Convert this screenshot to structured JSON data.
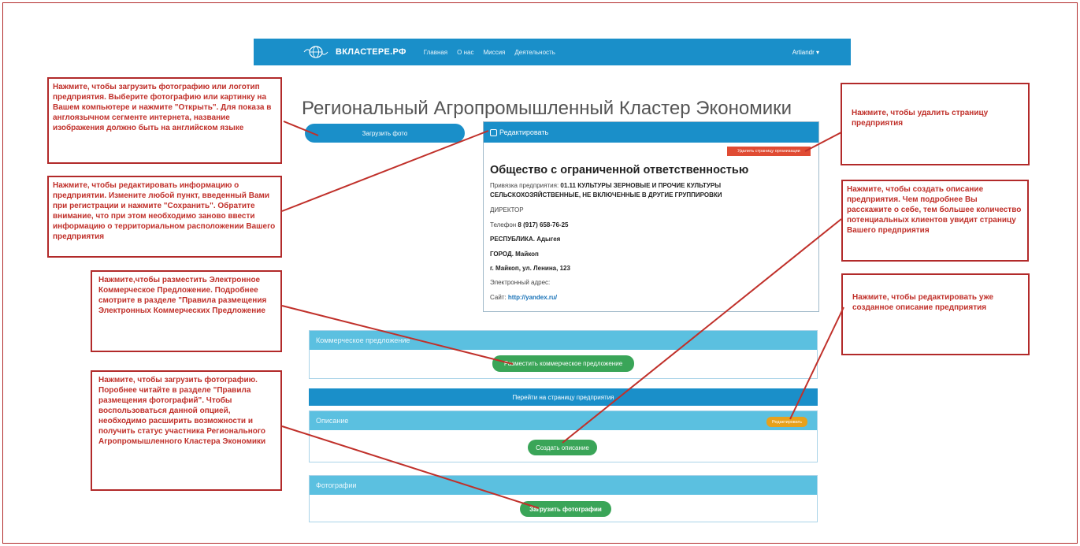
{
  "navbar": {
    "brand": "ВКЛАСТЕРЕ.РФ",
    "links": [
      "Главная",
      "О нас",
      "Миссия",
      "Деятельность"
    ],
    "user": "Artiandr ▾"
  },
  "page": {
    "title": "Региональный Агропромышленный Кластер Экономики",
    "upload_photo_label": "Загрузить фото"
  },
  "info": {
    "header_label": "Редактировать",
    "delete_label": "Удалить страницу организации",
    "org_name": "Общество с ограниченной ответственностью",
    "binding_label": "Привязка предприятия:",
    "binding_value_1": "01.11 КУЛЬТУРЫ ЗЕРНОВЫЕ И ПРОЧИЕ КУЛЬТУРЫ",
    "binding_value_2": "СЕЛЬСКОХОЗЯЙСТВЕННЫЕ, НЕ ВКЛЮЧЕННЫЕ В ДРУГИЕ ГРУППИРОВКИ",
    "director": "ДИРЕКТОР",
    "phone_label": "Телефон",
    "phone_value": "8 (917) 658-76-25",
    "republic": "РЕСПУБЛИКА. Адыгея",
    "city": "ГОРОД. Майкоп",
    "address": "г. Майкоп, ул. Ленина, 123",
    "email_label": "Электронный адрес:",
    "site_label": "Сайт:",
    "site_value": "http://yandex.ru/"
  },
  "commercial": {
    "header": "Коммерческое предложение",
    "button": "Разместить коммерческое предложение"
  },
  "goto_label": "Перейти на страницу предприятия",
  "description": {
    "header": "Описание",
    "edit_label": "Редактировать",
    "button": "Создать описание"
  },
  "photos": {
    "header": "Фотографии",
    "button": "Загрузить фотографии"
  },
  "notes": {
    "upload_photo": "Нажмите, чтобы загрузить фотографию или логотип предприятия. Выберите фотографию или картинку на Вашем компьютере и нажмите \"Открыть\". Для показа в англоязычном сегменте интернета, название изображения должно быть на английском языке",
    "edit_info": "Нажмите, чтобы редактировать информацию о предприятии. Измените любой пункт, введенный Вами при регистрации и нажмите \"Сохранить\". Обратите внимание, что при этом необходимо заново ввести информацию о территориальном расположении Вашего предприятия",
    "commercial": "Нажмите,чтобы разместить Электронное Коммерческое Предложение. Подробнее смотрите в разделе \"Правила размещения Электронных Коммерческих Предложение",
    "photos": "Нажмите, чтобы загрузить фотографию. Поробнее читайте в разделе \"Правила размещения фотографий\". Чтобы воспользоваться данной опцией, необходимо расширить возможности и получить статус участника Регионального Агропромышленного Кластера Экономики",
    "delete": "Нажмите, чтобы удалить страницу предприятия",
    "create_description": "Нажмите, чтобы создать описание предприятия. Чем подробнее Вы расскажите о себе, тем большее количество потенциальных клиентов увидит страницу Вашего предприятия",
    "edit_description": "Нажмите, чтобы редактировать уже созданное описание предприятия"
  },
  "colors": {
    "primary": "#1a8fc9",
    "section_header": "#5bc0e0",
    "success": "#3aa558",
    "danger": "#e04b33",
    "warning": "#e8a11b",
    "annotation": "#b22a2a"
  }
}
